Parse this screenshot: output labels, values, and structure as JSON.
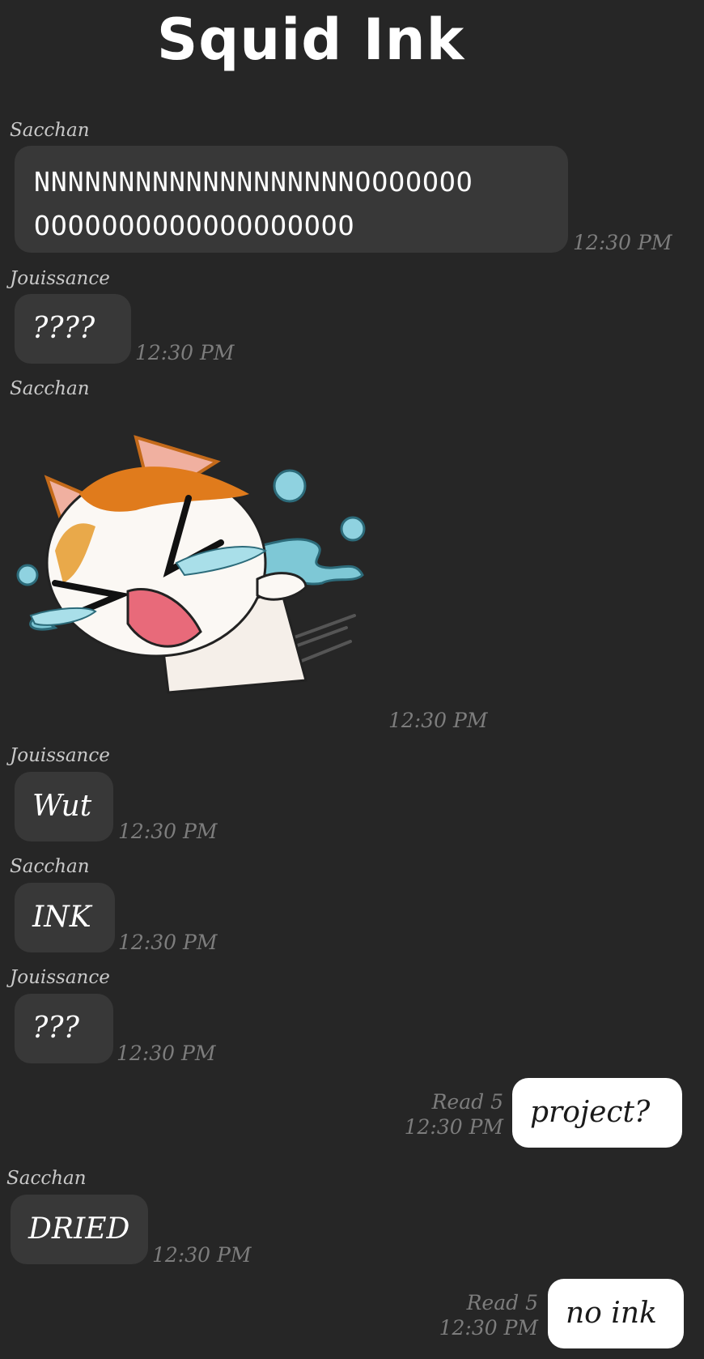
{
  "chat": {
    "title": "Squid Ink",
    "messages": [
      {
        "sender": "Sacchan",
        "text_line1": "NNNNNNNNNNNNNNNNNNNOOOOOOO",
        "text_line2": "OOOOOOOOOOOOOOOOOOO",
        "time": "12:30 PM"
      },
      {
        "sender": "Jouissance",
        "text": "????",
        "time": "12:30 PM"
      },
      {
        "sender": "Sacchan",
        "sticker": "crying-cat-sticker",
        "time": "12:30 PM"
      },
      {
        "sender": "Jouissance",
        "text": "Wut",
        "time": "12:30 PM"
      },
      {
        "sender": "Sacchan",
        "text": "INK",
        "time": "12:30 PM"
      },
      {
        "sender": "Jouissance",
        "text": "???",
        "time": "12:30 PM"
      },
      {
        "outgoing": true,
        "text": "project?",
        "read": "Read 5",
        "time": "12:30 PM"
      },
      {
        "sender": "Sacchan",
        "text": "DRIED",
        "time": "12:30 PM"
      },
      {
        "outgoing": true,
        "text": "no ink",
        "read": "Read 5",
        "time": "12:30 PM"
      }
    ]
  },
  "colors": {
    "background": "#262626",
    "incoming_bubble": "#383838",
    "outgoing_bubble": "#ffffff",
    "timestamp": "#7d7d7d"
  }
}
